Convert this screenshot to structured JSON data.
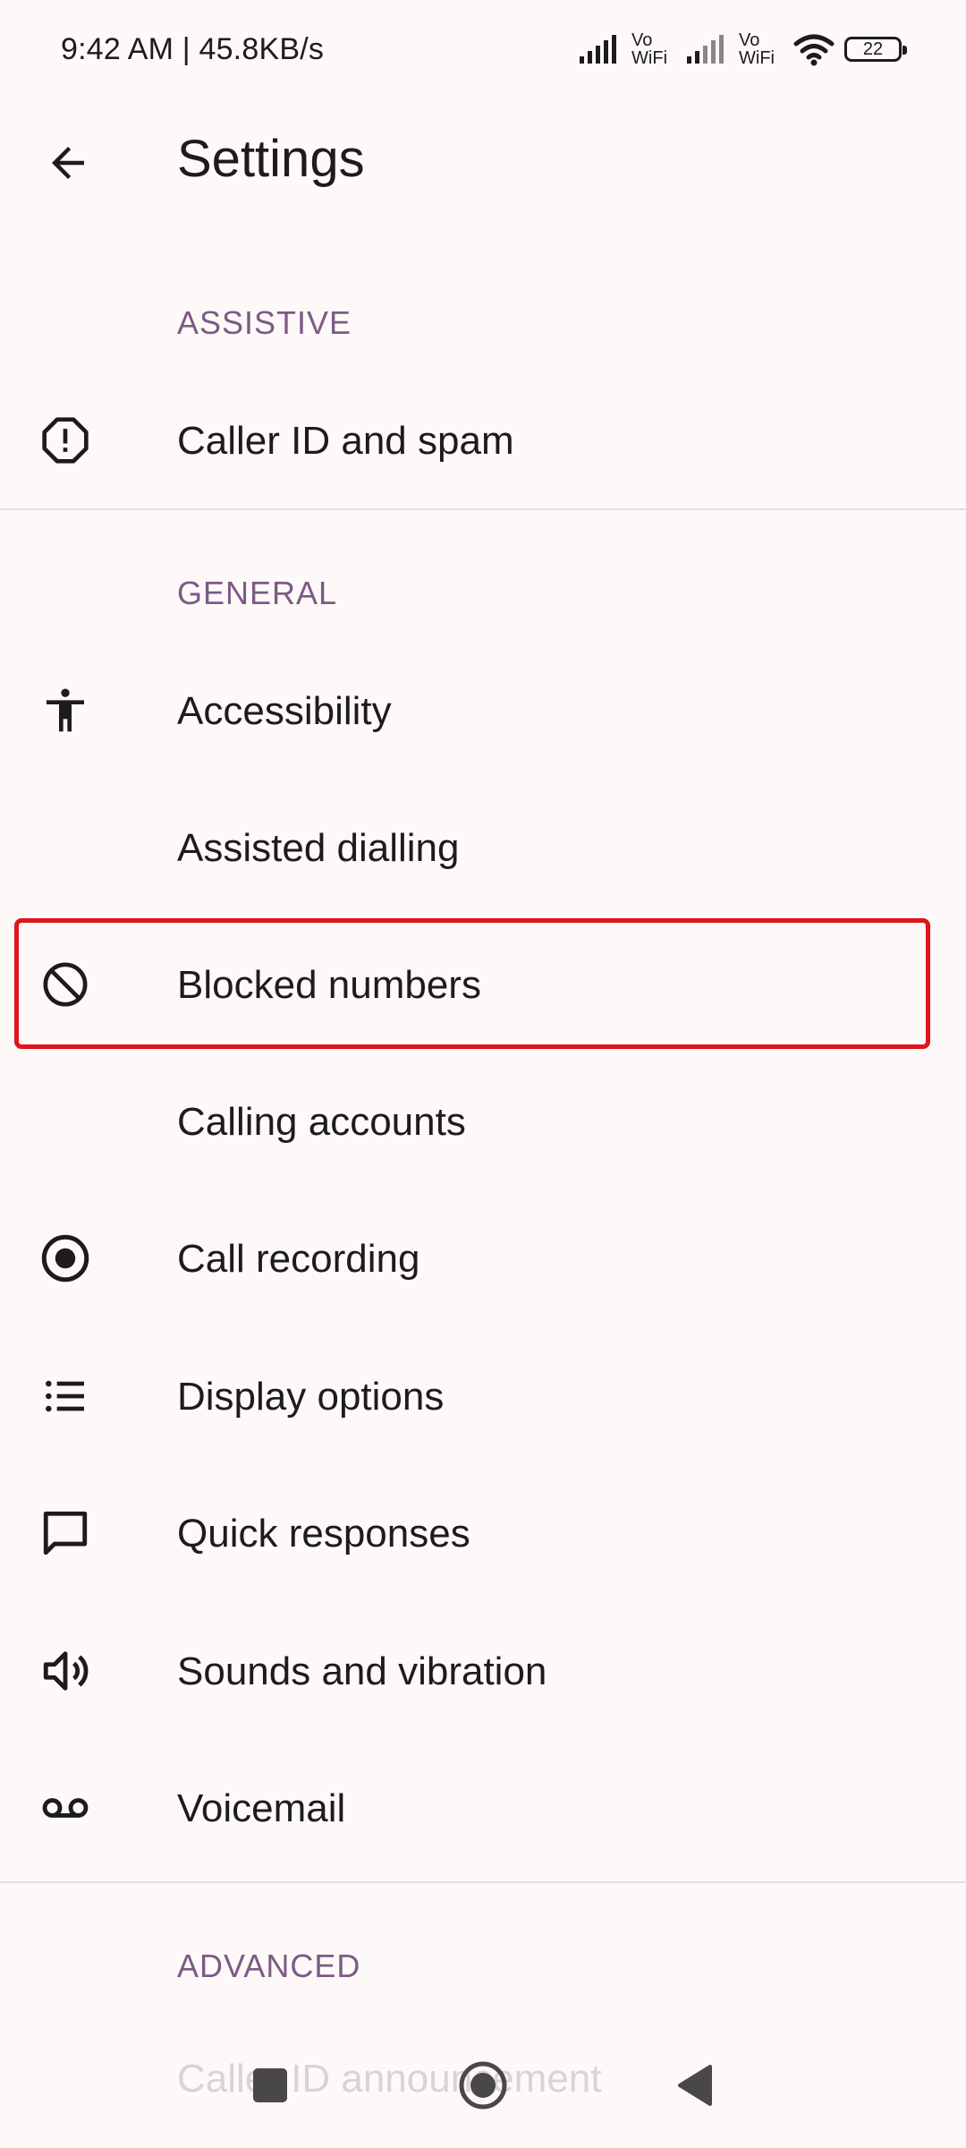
{
  "status_bar": {
    "time_speed": "9:42 AM | 45.8KB/s",
    "vowifi_1": [
      "Vo",
      "WiFi"
    ],
    "vowifi_2": [
      "Vo",
      "WiFi"
    ],
    "battery": "22"
  },
  "app_bar": {
    "title": "Settings",
    "back_icon": "arrow-back-icon"
  },
  "sections": {
    "assistive": "ASSISTIVE",
    "general": "GENERAL",
    "advanced": "ADVANCED"
  },
  "items": [
    {
      "label": "Caller ID and spam",
      "icon": "alert-octagon-icon"
    },
    {
      "label": "Accessibility",
      "icon": "accessibility-icon"
    },
    {
      "label": "Assisted dialling",
      "icon": ""
    },
    {
      "label": "Blocked numbers",
      "icon": "block-icon"
    },
    {
      "label": "Calling accounts",
      "icon": ""
    },
    {
      "label": "Call recording",
      "icon": "record-icon"
    },
    {
      "label": "Display options",
      "icon": "list-icon"
    },
    {
      "label": "Quick responses",
      "icon": "chat-bubble-icon"
    },
    {
      "label": "Sounds and vibration",
      "icon": "volume-icon"
    },
    {
      "label": "Voicemail",
      "icon": "voicemail-icon"
    }
  ],
  "faded_item": "Caller ID announcement",
  "nav_bar": {
    "recents": "square-icon",
    "home": "circle-icon",
    "back": "triangle-back-icon"
  },
  "colors": {
    "background": "#fdf9f8",
    "section_header": "#7d5a86",
    "highlight_border": "#e0141b"
  }
}
